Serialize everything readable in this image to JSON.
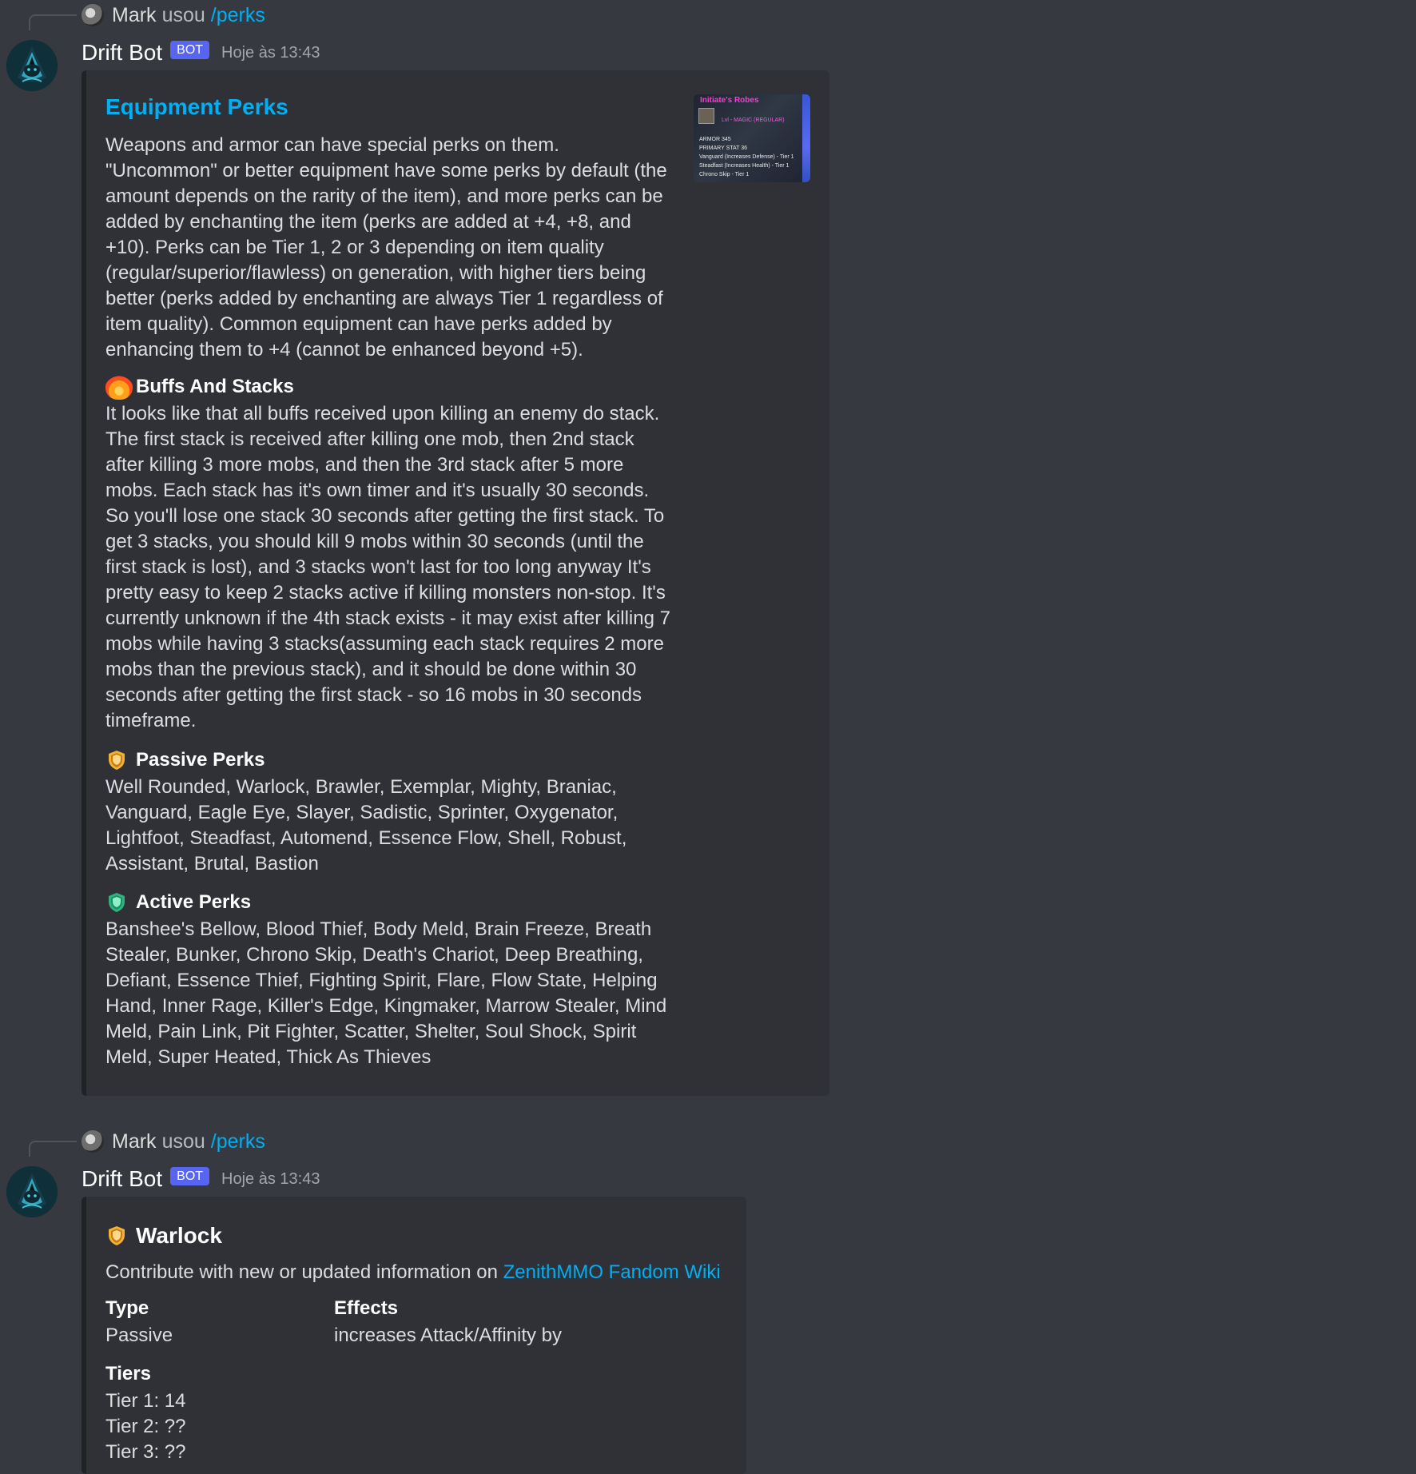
{
  "channel": {
    "background_color": "#36393f",
    "embed_color": "#2f3136",
    "link_color": "#00aff4",
    "bot_tag_color": "#5865f2"
  },
  "messages": [
    {
      "reply": {
        "name": "Mark",
        "used_text": "usou",
        "command": "/perks"
      },
      "author": {
        "name": "Drift Bot",
        "bot_tag": "BOT",
        "timestamp": "Hoje às 13:43"
      },
      "embed": {
        "title": "Equipment Perks",
        "description": "Weapons and armor can have special perks on them. \"Uncommon\" or better equipment have some perks by default (the amount depends on the rarity of the item), and more perks can be added by enchanting the item (perks are added at +4, +8, and +10). Perks can be Tier 1, 2 or 3 depending on item quality (regular/superior/flawless) on generation, with higher tiers being better (perks added by enchanting are always Tier 1 regardless of item quality). Common equipment can have perks added by enhancing them to +4 (cannot be enhanced beyond +5).",
        "thumbnail": {
          "title": "Initiate's Robes",
          "rarity": "Lvl - MAGIC (REGULAR)",
          "lines": [
            "ARMOR 345",
            "PRIMARY STAT 36",
            "Vanguard (Increases Defense) - Tier 1",
            "Steadfast (Increases Health) - Tier 1",
            "Chrono Skip - Tier 1"
          ]
        },
        "fields": [
          {
            "emoji": "fire-icon",
            "name": "Buffs And Stacks",
            "value": "It looks like that all buffs received upon killing an enemy do stack. The first stack is received after killing one mob, then 2nd stack after killing 3 more mobs, and then the 3rd stack after 5 more mobs. Each stack has it's own timer and it's usually 30 seconds. So you'll lose one stack 30 seconds after getting the first stack. To get 3 stacks, you should kill 9 mobs within 30 seconds (until the first stack is lost), and 3 stacks won't last for too long anyway It's pretty easy to keep 2 stacks active if killing monsters non-stop. It's currently unknown if the 4th stack exists - it may exist after killing 7 mobs while having 3 stacks(assuming each stack requires 2 more mobs than the previous stack), and it should be done within 30 seconds after getting the first stack - so 16 mobs in 30 seconds timeframe."
          },
          {
            "emoji": "shield-icon",
            "name": "Passive Perks",
            "value": "Well Rounded, Warlock, Brawler, Exemplar, Mighty, Braniac, Vanguard, Eagle Eye, Slayer, Sadistic, Sprinter, Oxygenator, Lightfoot, Steadfast, Automend, Essence Flow, Shell, Robust, Assistant, Brutal, Bastion"
          },
          {
            "emoji": "shield-icon",
            "name": "Active Perks",
            "value": "Banshee's Bellow, Blood Thief, Body Meld, Brain Freeze, Breath Stealer, Bunker, Chrono Skip, Death's Chariot, Deep Breathing, Defiant, Essence Thief, Fighting Spirit, Flare, Flow State, Helping Hand, Inner Rage, Killer's Edge, Kingmaker, Marrow Stealer, Mind Meld, Pain Link, Pit Fighter, Scatter, Shelter, Soul Shock, Spirit Meld, Super Heated, Thick As Thieves"
          }
        ]
      }
    },
    {
      "reply": {
        "name": "Mark",
        "used_text": "usou",
        "command": "/perks"
      },
      "author": {
        "name": "Drift Bot",
        "bot_tag": "BOT",
        "timestamp": "Hoje às 13:43"
      },
      "embed": {
        "emoji": "shield-icon",
        "title": "Warlock",
        "contribute_prefix": "Contribute with new or updated information on",
        "contribute_link": "ZenithMMO Fandom Wiki",
        "type_label": "Type",
        "type_value": "Passive",
        "effects_label": "Effects",
        "effects_value": "increases Attack/Affinity by",
        "tiers_label": "Tiers",
        "tiers": [
          "Tier 1: 14",
          "Tier 2: ??",
          "Tier 3: ??"
        ]
      }
    }
  ]
}
